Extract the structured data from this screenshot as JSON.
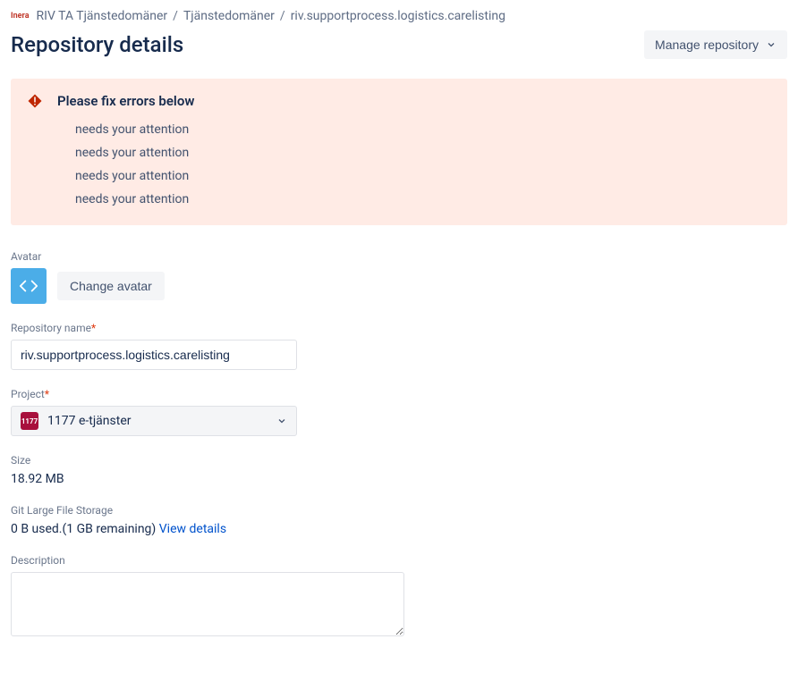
{
  "breadcrumb": {
    "logo_text": "Inera",
    "items": [
      "RIV TA Tjänstedomäner",
      "Tjänstedomäner",
      "riv.supportprocess.logistics.carelisting"
    ]
  },
  "header": {
    "title": "Repository details",
    "manage_label": "Manage repository"
  },
  "error_panel": {
    "title": "Please fix errors below",
    "items": [
      "needs your attention",
      "needs your attention",
      "needs your attention",
      "needs your attention"
    ]
  },
  "avatar": {
    "label": "Avatar",
    "change_button": "Change avatar"
  },
  "repo_name": {
    "label": "Repository name",
    "value": "riv.supportprocess.logistics.carelisting"
  },
  "project": {
    "label": "Project",
    "icon_text": "1177",
    "value": "1177 e-tjänster"
  },
  "size": {
    "label": "Size",
    "value": "18.92 MB"
  },
  "lfs": {
    "label": "Git Large File Storage",
    "used_text": "0 B used.(1 GB remaining) ",
    "link_text": "View details"
  },
  "description": {
    "label": "Description",
    "value": ""
  }
}
